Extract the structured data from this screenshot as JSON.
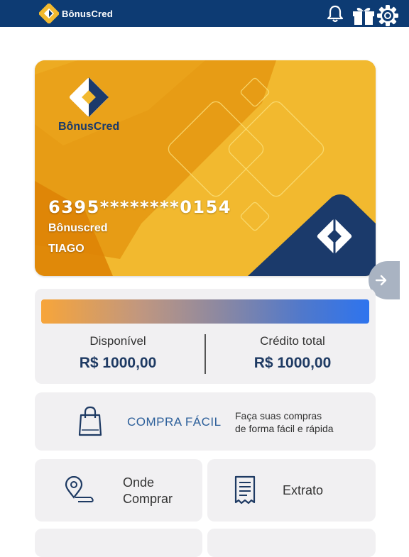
{
  "header": {
    "brand_name": "BônusCred",
    "icons": [
      "notification-bell-icon",
      "gift-icon",
      "settings-gear-icon"
    ]
  },
  "card": {
    "logo_text": "BônusCred",
    "number": "6395********0154",
    "brand": "Bônuscred",
    "holder": "TIAGO"
  },
  "balance": {
    "available_label": "Disponível",
    "available_value": "R$ 1000,00",
    "total_label": "Crédito total",
    "total_value": "R$ 1000,00"
  },
  "compra_facil": {
    "label": "COMPRA FÁCIL",
    "desc_line1": "Faça suas compras",
    "desc_line2": "de forma fácil e rápida",
    "icon": "shopping-bag-icon"
  },
  "tiles": [
    {
      "line1": "Onde",
      "line2": "Comprar",
      "icon": "location-pin-icon"
    },
    {
      "label": "Extrato",
      "icon": "receipt-icon"
    }
  ],
  "colors": {
    "header_bg": "#0d3b73",
    "brand_navy": "#1a3a6b",
    "card_yellow": "#f2b92f",
    "card_orange": "#e08a0c",
    "accent_blue": "#2c5f9a",
    "panel_bg": "#f1f0f2"
  }
}
